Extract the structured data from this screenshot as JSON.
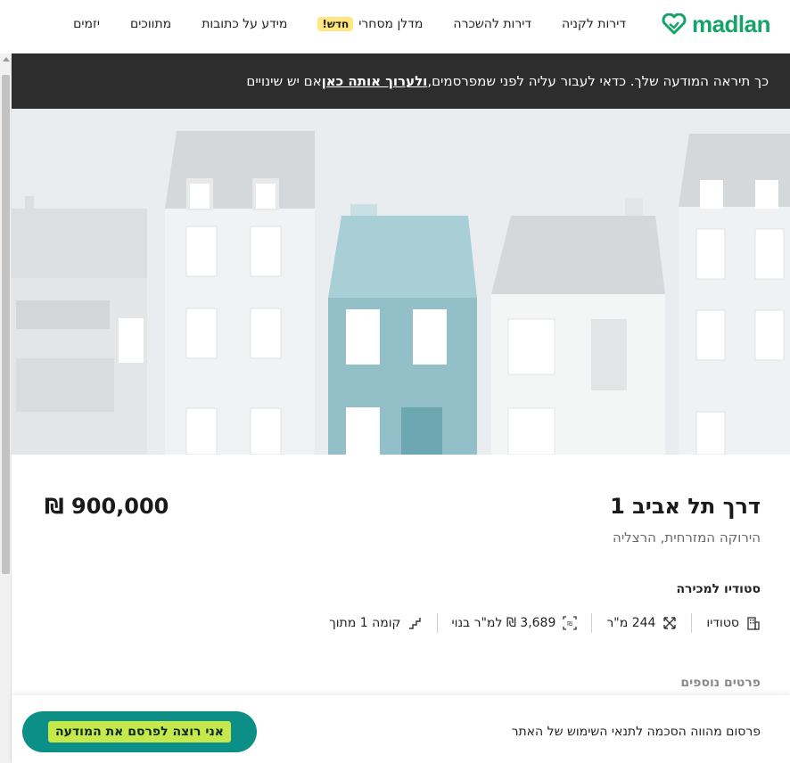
{
  "nav": {
    "logo_text": "madlan",
    "items": [
      {
        "label": "דירות לקניה"
      },
      {
        "label": "דירות להשכרה"
      },
      {
        "label": "מדלן מסחרי",
        "badge": "חדש!"
      },
      {
        "label": "מידע על כתובות"
      },
      {
        "label": "מתווכים"
      },
      {
        "label": "יזמים"
      }
    ]
  },
  "banner": {
    "text_before": "כך תיראה המודעה שלך. כדאי לעבור עליה לפני שמפרסמים, ",
    "link_text": "ולערוך אותה כאן",
    "text_after": " אם יש שינויים"
  },
  "listing": {
    "title": "דרך תל אביב 1",
    "price": "₪ 900,000",
    "subtitle": "הירוקה המזרחית, הרצליה",
    "property_type": "סטודיו למכירה",
    "specs": [
      {
        "icon": "building-icon",
        "label": "סטודיו"
      },
      {
        "icon": "expand-icon",
        "label": "244 מ\"ר"
      },
      {
        "icon": "price-per-meter-icon",
        "label": "3,689 ₪ למ\"ר בנוי"
      },
      {
        "icon": "stairs-icon",
        "label": "קומה 1 מתוך"
      }
    ],
    "more_details": "פרטים נוספים"
  },
  "bottom": {
    "terms": "פרסום מהווה הסכמה לתנאי השימוש של האתר",
    "publish_label": "אני רוצה לפרסם את המודעה"
  },
  "colors": {
    "brand": "#16a36a",
    "banner_bg": "#2d2d2d",
    "button_bg": "#0b8f86",
    "button_highlight": "#c7e84a"
  }
}
